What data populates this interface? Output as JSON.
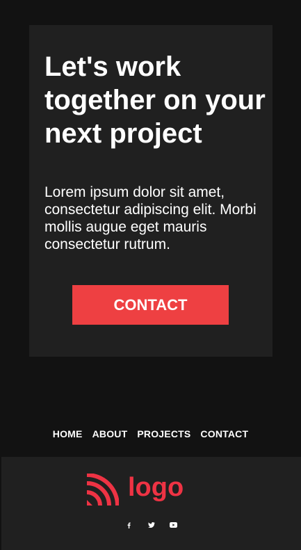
{
  "cta": {
    "heading": "Let's work together on your next project",
    "body": "Lorem ipsum dolor sit amet, consectetur adipiscing elit. Morbi mollis augue eget mauris consectetur rutrum.",
    "button_label": "CONTACT"
  },
  "nav": {
    "items": [
      {
        "label": "HOME"
      },
      {
        "label": "ABOUT"
      },
      {
        "label": "PROJECTS"
      },
      {
        "label": "CONTACT"
      }
    ]
  },
  "footer": {
    "logo_text": "logo",
    "logo_icon": "signal-waves-icon",
    "social": [
      {
        "icon": "facebook-icon"
      },
      {
        "icon": "twitter-icon"
      },
      {
        "icon": "youtube-icon"
      }
    ]
  },
  "colors": {
    "page_background": "#121212",
    "card_background": "#202020",
    "accent": "#ee4042",
    "logo": "#ee3344",
    "text": "#ffffff"
  }
}
